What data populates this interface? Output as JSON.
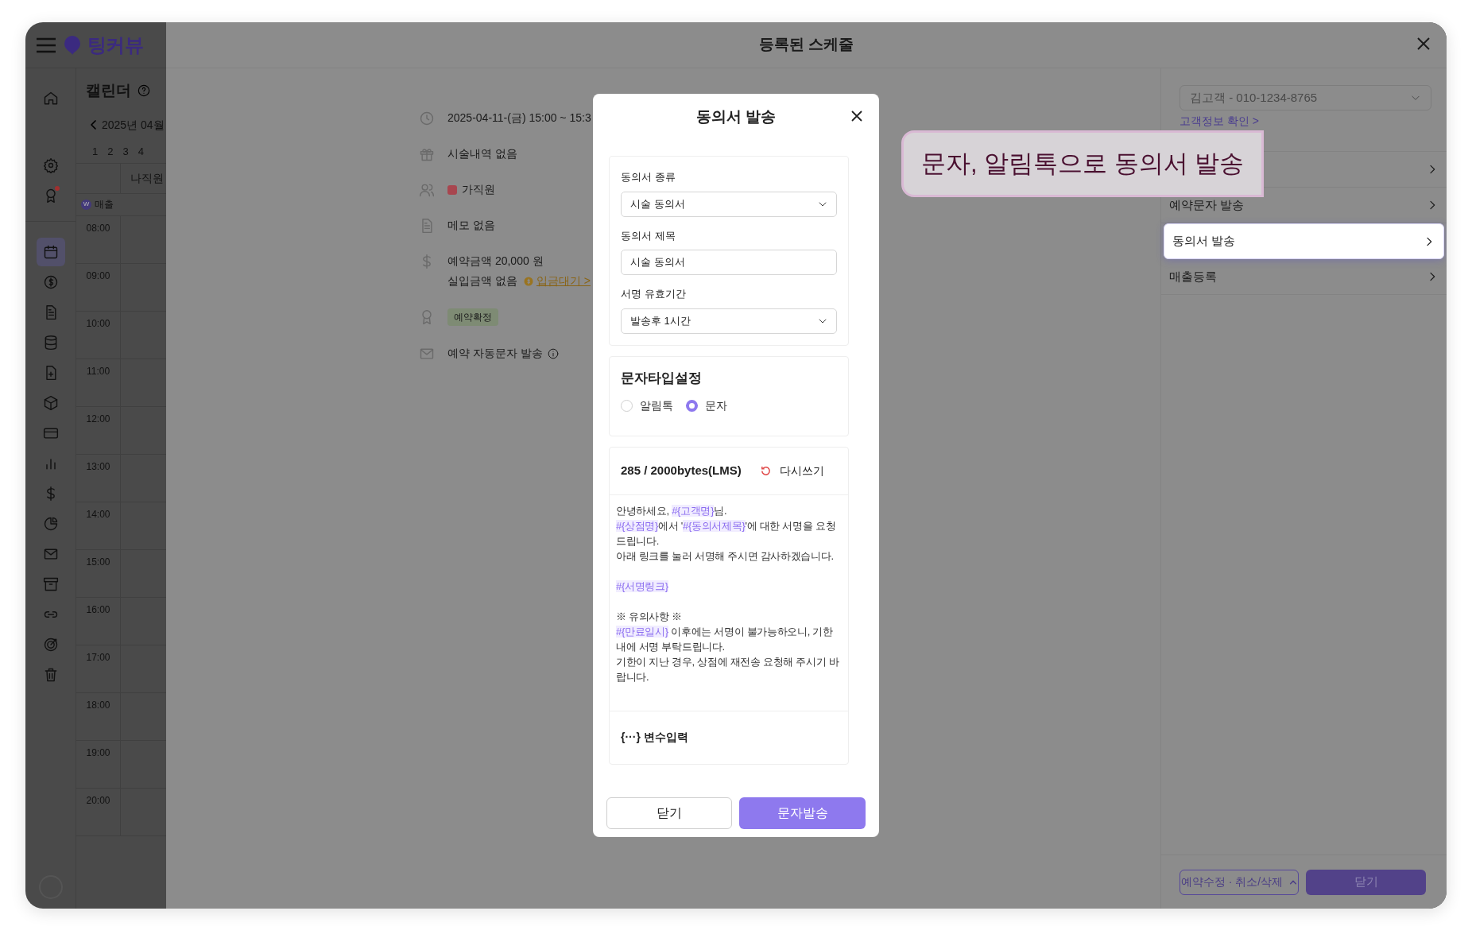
{
  "app": {
    "logo": "팅커뷰",
    "nav_items": [
      {
        "selected": false,
        "badge": false
      },
      {
        "selected": false,
        "badge": false
      },
      {
        "selected": false,
        "badge": true
      },
      {
        "selected": true,
        "badge": false
      },
      {
        "selected": false,
        "badge": false
      },
      {
        "selected": false,
        "badge": false
      },
      {
        "selected": false,
        "badge": false
      },
      {
        "selected": false,
        "badge": false
      },
      {
        "selected": false,
        "badge": false
      },
      {
        "selected": false,
        "badge": false
      },
      {
        "selected": false,
        "badge": false
      },
      {
        "selected": false,
        "badge": false
      },
      {
        "selected": false,
        "badge": false
      },
      {
        "selected": false,
        "badge": false
      },
      {
        "selected": false,
        "badge": false
      },
      {
        "selected": false,
        "badge": false
      },
      {
        "selected": false,
        "badge": false
      },
      {
        "selected": false,
        "badge": false
      }
    ]
  },
  "calendar": {
    "title": "캘린더",
    "month": "2025년 04월",
    "weeks": [
      "1",
      "2",
      "3",
      "4"
    ],
    "staff": "나직원",
    "sales_badge": "W",
    "sales_label": "매출",
    "times": [
      "08:00",
      "09:00",
      "10:00",
      "11:00",
      "12:00",
      "13:00",
      "14:00",
      "15:00",
      "16:00",
      "17:00",
      "18:00",
      "19:00",
      "20:00"
    ]
  },
  "schedule": {
    "title": "등록된 스케줄",
    "details": [
      {
        "kind": "text",
        "text": "2025-04-11-(금) 15:00 ~ 15:3"
      },
      {
        "kind": "text",
        "text": "시술내역 없음"
      },
      {
        "kind": "staff",
        "text": "가직원",
        "color": "#a8464f"
      },
      {
        "kind": "text",
        "text": "메모 없음"
      },
      {
        "kind": "amount",
        "text": "예약금액 20,000 원",
        "sub": "실입금액 없음",
        "link": "입금대기 >"
      },
      {
        "kind": "badge",
        "text": "예약확정"
      },
      {
        "kind": "info",
        "text": "예약 자동문자 발송"
      }
    ],
    "customer_select": {
      "placeholder": "김고객 - 010-1234-8765"
    },
    "customer_link": "고객정보 확인 >",
    "menu": [
      {
        "selected": false
      },
      {
        "label": "예약문자 발송",
        "selected": false
      },
      {
        "label": "동의서 발송",
        "selected": true
      },
      {
        "label": "매출등록",
        "selected": false
      }
    ],
    "footer": {
      "edit_button": "예약수정 · 취소/삭제",
      "close_button": "닫기"
    }
  },
  "dialog": {
    "title": "동의서 발송",
    "fields": [
      {
        "kind": "select",
        "label": "동의서 종류",
        "value": "시술 동의서"
      },
      {
        "kind": "input",
        "label": "동의서 제목",
        "value": "시술 동의서"
      },
      {
        "kind": "select",
        "label": "서명 유효기간",
        "value": "발송후 1시간"
      }
    ],
    "message_type": {
      "title": "문자타입설정",
      "options": [
        {
          "label": "알림톡",
          "selected": false
        },
        {
          "label": "문자",
          "selected": true
        }
      ]
    },
    "message": {
      "byte_count": "285 / 2000bytes(LMS)",
      "reset": "다시쓰기",
      "paragraphs": [
        [
          "안녕하세요, **#{고객명}**님.",
          "**#{상점명}**에서 '**#{동의서제목}**'에 대한 서명을 요청드립니다.",
          "아래 링크를 눌러 서명해 주시면 감사하겠습니다."
        ],
        [
          "**#{서명링크}**"
        ],
        [
          "※ 유의사항 ※",
          "**#{만료일시}** 이후에는 서명이 불가능하오니, 기한 내에 서명 부탁드립니다.",
          "기한이 지난 경우, 상점에 재전송 요청해 주시기 바랍니다."
        ]
      ],
      "variable_button": "{···} 변수입력"
    },
    "buttons": {
      "close": "닫기",
      "send": "문자발송"
    }
  },
  "callout": {
    "text": "문자, 알림톡으로 동의서 발송"
  }
}
